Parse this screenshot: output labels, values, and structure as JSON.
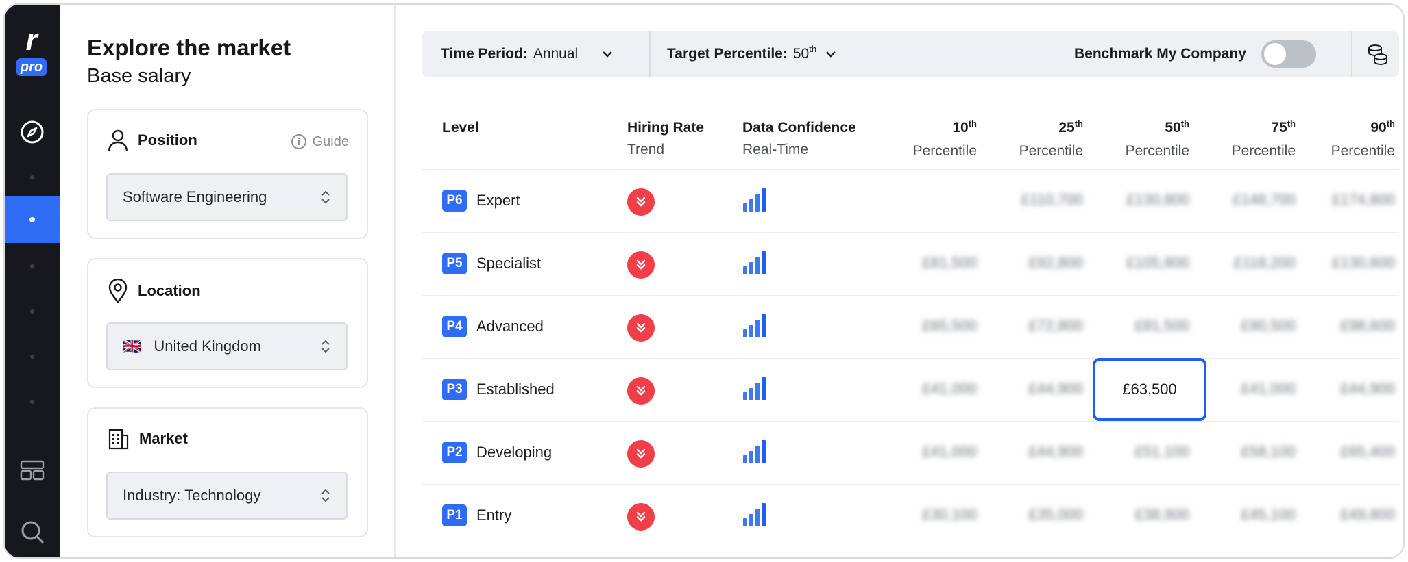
{
  "logo": {
    "letter": "r",
    "badge": "pro"
  },
  "panel": {
    "title": "Explore the market",
    "subtitle": "Base salary",
    "position": {
      "label": "Position",
      "guide": "Guide",
      "value": "Software Engineering",
      "icon": "person-icon"
    },
    "location": {
      "label": "Location",
      "value": "United Kingdom",
      "flag": "🇬🇧",
      "icon": "map-pin-icon"
    },
    "market": {
      "label": "Market",
      "value": "Industry: Technology",
      "icon": "building-icon"
    }
  },
  "toolbar": {
    "time_period_label": "Time Period:",
    "time_period_value": "Annual",
    "target_percentile_label": "Target Percentile:",
    "target_percentile_value": "50",
    "target_percentile_suffix": "th",
    "benchmark_label": "Benchmark My Company",
    "benchmark_on": false
  },
  "table": {
    "headers": {
      "level": "Level",
      "hiring_rate": "Hiring Rate",
      "hiring_rate_sub": "Trend",
      "data_confidence": "Data Confidence",
      "data_confidence_sub": "Real-Time",
      "percentile_word": "Percentile",
      "th_suffix": "th",
      "percentiles": [
        "10",
        "25",
        "50",
        "75",
        "90"
      ]
    },
    "rows": [
      {
        "code": "P6",
        "name": "Expert",
        "values": [
          "",
          "£110,700",
          "£130,800",
          "£148,700",
          "£174,800"
        ]
      },
      {
        "code": "P5",
        "name": "Specialist",
        "values": [
          "£81,500",
          "£92,800",
          "£105,800",
          "£118,200",
          "£130,600"
        ]
      },
      {
        "code": "P4",
        "name": "Advanced",
        "values": [
          "£65,500",
          "£72,800",
          "£81,500",
          "£90,500",
          "£98,600"
        ]
      },
      {
        "code": "P3",
        "name": "Established",
        "values": [
          "£41,000",
          "£44,900",
          "£63,500",
          "£41,000",
          "£44,900"
        ]
      },
      {
        "code": "P2",
        "name": "Developing",
        "values": [
          "£41,000",
          "£44,900",
          "£51,100",
          "£58,100",
          "£65,400"
        ]
      },
      {
        "code": "P1",
        "name": "Entry",
        "values": [
          "£30,100",
          "£35,000",
          "£38,900",
          "£45,100",
          "£49,800"
        ]
      }
    ],
    "highlight_value": "£63,500"
  },
  "colors": {
    "accent": "#2e6cf6",
    "trend_down": "#f23e48",
    "rail": "#16181d"
  }
}
